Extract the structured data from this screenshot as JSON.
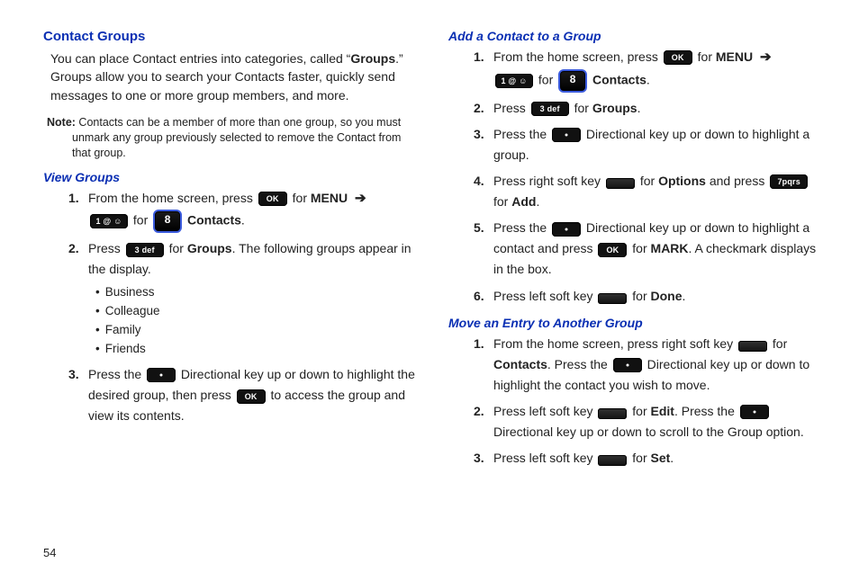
{
  "page_number": "54",
  "left": {
    "h1": "Contact Groups",
    "intro_pre": "You can place Contact entries into categories, called “",
    "intro_bold": "Groups",
    "intro_post": ".” Groups allow you to search your Contacts faster, quickly send messages to one or more group members, and more.",
    "note_label": "Note:",
    "note": " Contacts can be a member of more than one group, so you must unmark any group previously selected to remove the Contact from that group.",
    "h2": "View Groups",
    "s1a": "From the home screen, press ",
    "s1b": " for ",
    "s1c": "MENU",
    "s1d": " for ",
    "s1e": "Contacts",
    "s1_dot": ".",
    "s2a": "Press ",
    "s2b": " for ",
    "s2c": "Groups",
    "s2d": ". The following groups appear in the display.",
    "bul": [
      "Business",
      "Colleague",
      "Family",
      "Friends"
    ],
    "s3a": "Press the ",
    "s3b": " Directional key up or down to highlight the desired group, then press ",
    "s3c": " to access the group and view its contents."
  },
  "right": {
    "h2a": "Add a Contact to a Group",
    "a1a": "From the home screen, press ",
    "a1b": " for ",
    "a1c": "MENU",
    "a1d": " for ",
    "a1e": "Contacts",
    "a1_dot": ".",
    "a2a": "Press ",
    "a2b": " for ",
    "a2c": "Groups",
    "a2_dot": ".",
    "a3a": "Press the ",
    "a3b": " Directional key up or down to highlight a group.",
    "a4a": "Press right soft key ",
    "a4b": " for ",
    "a4c": "Options",
    "a4d": " and press ",
    "a4e": " for ",
    "a4f": "Add",
    "a4_dot": ".",
    "a5a": "Press the ",
    "a5b": " Directional key up or down to highlight a contact and press ",
    "a5c": " for ",
    "a5d": "MARK",
    "a5e": ". A checkmark displays in the box.",
    "a6a": "Press left soft key ",
    "a6b": " for ",
    "a6c": "Done",
    "a6_dot": ".",
    "h2b": "Move an Entry to Another Group",
    "m1a": "From the home screen, press right soft key ",
    "m1b": " for ",
    "m1c": "Contacts",
    "m1d": ". Press the ",
    "m1e": " Directional key up or down to highlight the contact you wish to move.",
    "m2a": "Press left soft key ",
    "m2b": " for ",
    "m2c": "Edit",
    "m2d": ". Press the ",
    "m2e": " Directional key up or down to scroll to the Group option.",
    "m3a": "Press left soft key ",
    "m3b": " for ",
    "m3c": "Set",
    "m3_dot": "."
  },
  "icons": {
    "ok": "OK",
    "key1": "1 @ ☺",
    "key3": "3 def",
    "key7": "7pqrs",
    "contacts": "8"
  }
}
